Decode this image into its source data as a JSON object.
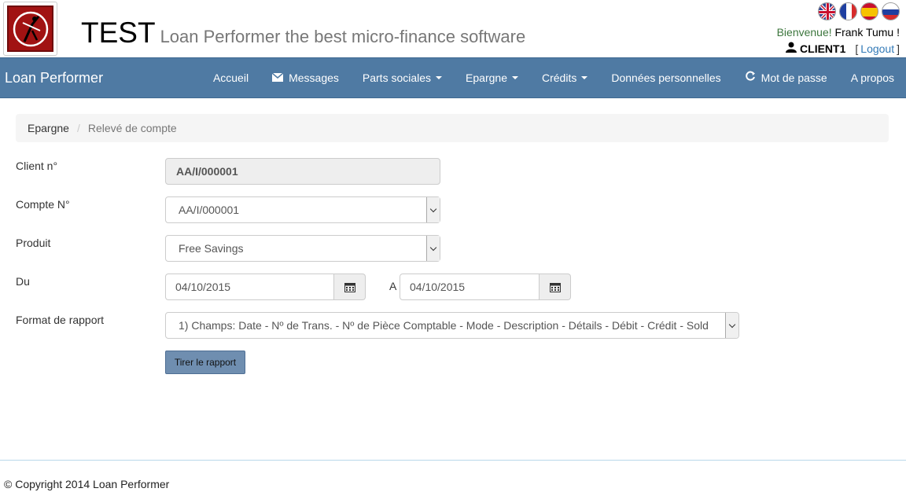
{
  "header": {
    "app_title": "TEST",
    "app_subtitle": "Loan Performer the best micro-finance software",
    "flags": [
      "uk-flag-icon",
      "france-flag-icon",
      "spain-flag-icon",
      "russia-flag-icon"
    ],
    "welcome_greeting": "Bienvenue!",
    "welcome_name": "Frank Tumu !",
    "username": "CLIENT1",
    "bracket_open": "[",
    "logout_label": "Logout",
    "bracket_close": "]"
  },
  "navbar": {
    "brand": "Loan Performer",
    "items": [
      {
        "label": "Accueil"
      },
      {
        "label": "Messages",
        "icon": "envelope-icon"
      },
      {
        "label": "Parts sociales",
        "dropdown": true
      },
      {
        "label": "Epargne",
        "dropdown": true
      },
      {
        "label": "Crédits",
        "dropdown": true
      },
      {
        "label": "Données personnelles"
      },
      {
        "label": "Mot de passe",
        "icon": "refresh-icon"
      },
      {
        "label": "A propos"
      }
    ]
  },
  "breadcrumb": {
    "parent": "Epargne",
    "separator": "/",
    "current": "Relevé de compte"
  },
  "form": {
    "client_label": "Client n°",
    "client_value": "AA/I/000001",
    "compte_label": "Compte N°",
    "compte_value": "AA/I/000001",
    "produit_label": "Produit",
    "produit_value": "Free Savings",
    "du_label": "Du",
    "date_from": "04/10/2015",
    "a_label": "A",
    "date_to": "04/10/2015",
    "format_label": "Format de rapport",
    "format_value": "1) Champs: Date - Nº de Trans. - Nº de Pièce Comptable - Mode - Description - Détails - Débit - Crédit - Sold",
    "submit_label": "Tirer le rapport"
  },
  "footer": {
    "copyright": "© Copyright 2014 Loan Performer"
  },
  "colors": {
    "navbar_bg": "#4f7aa3",
    "button_bg": "#6f8eb0",
    "greeting": "#3c763d",
    "link": "#337ab7"
  }
}
